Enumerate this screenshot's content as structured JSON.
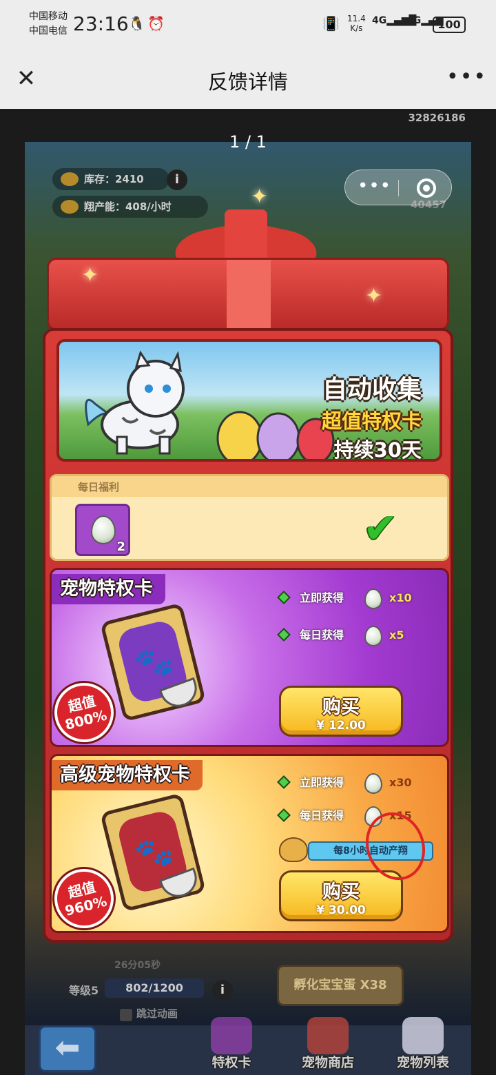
{
  "status_bar": {
    "carrier_1": "中国移动",
    "carrier_2": "中国电信",
    "time": "23:16",
    "net_speed_value": "11.4",
    "net_speed_unit": "K/s",
    "net_1": "4G",
    "net_2": "4G",
    "battery": "100"
  },
  "nav": {
    "title": "反馈详情"
  },
  "viewer": {
    "image_id": "32826186",
    "page_counter": "1 / 1"
  },
  "game": {
    "hud": {
      "stock_label": "库存：2410",
      "production_label": "翔产能：408/小时",
      "coins": "40457"
    },
    "banner": {
      "title": "自动收集",
      "subtitle": "超值特权卡",
      "duration": "持续30天"
    },
    "daily": {
      "label": "每日福利",
      "reward_count": "2",
      "claimed": true
    },
    "cards": [
      {
        "title": "宠物特权卡",
        "perk_1": "立即获得",
        "perk_1_amount": "x10",
        "perk_2": "每日获得",
        "perk_2_amount": "x5",
        "badge_line1": "超值",
        "badge_line2": "800%",
        "buy_label": "购买",
        "price": "¥ 12.00"
      },
      {
        "title": "高级宠物特权卡",
        "perk_1": "立即获得",
        "perk_1_amount": "x30",
        "perk_2": "每日获得",
        "perk_2_amount": "x15",
        "auto_text": "每8小时自动产翔",
        "badge_line1": "超值",
        "badge_line2": "960%",
        "buy_label": "购买",
        "price": "¥ 30.00"
      }
    ],
    "bottom": {
      "timer": "26分05秒",
      "level_label": "等级5",
      "level_progress": "802/1200",
      "skip_label": "跳过动画",
      "hatch_button": "孵化宝宝蛋 X38",
      "dock": [
        "特权卡",
        "宠物商店",
        "宠物列表"
      ]
    }
  },
  "colors": {
    "annotation_circle": "#e02424",
    "check": "#2fc02a",
    "purple_card": "#a33ad1",
    "orange_card": "#f9a846"
  }
}
